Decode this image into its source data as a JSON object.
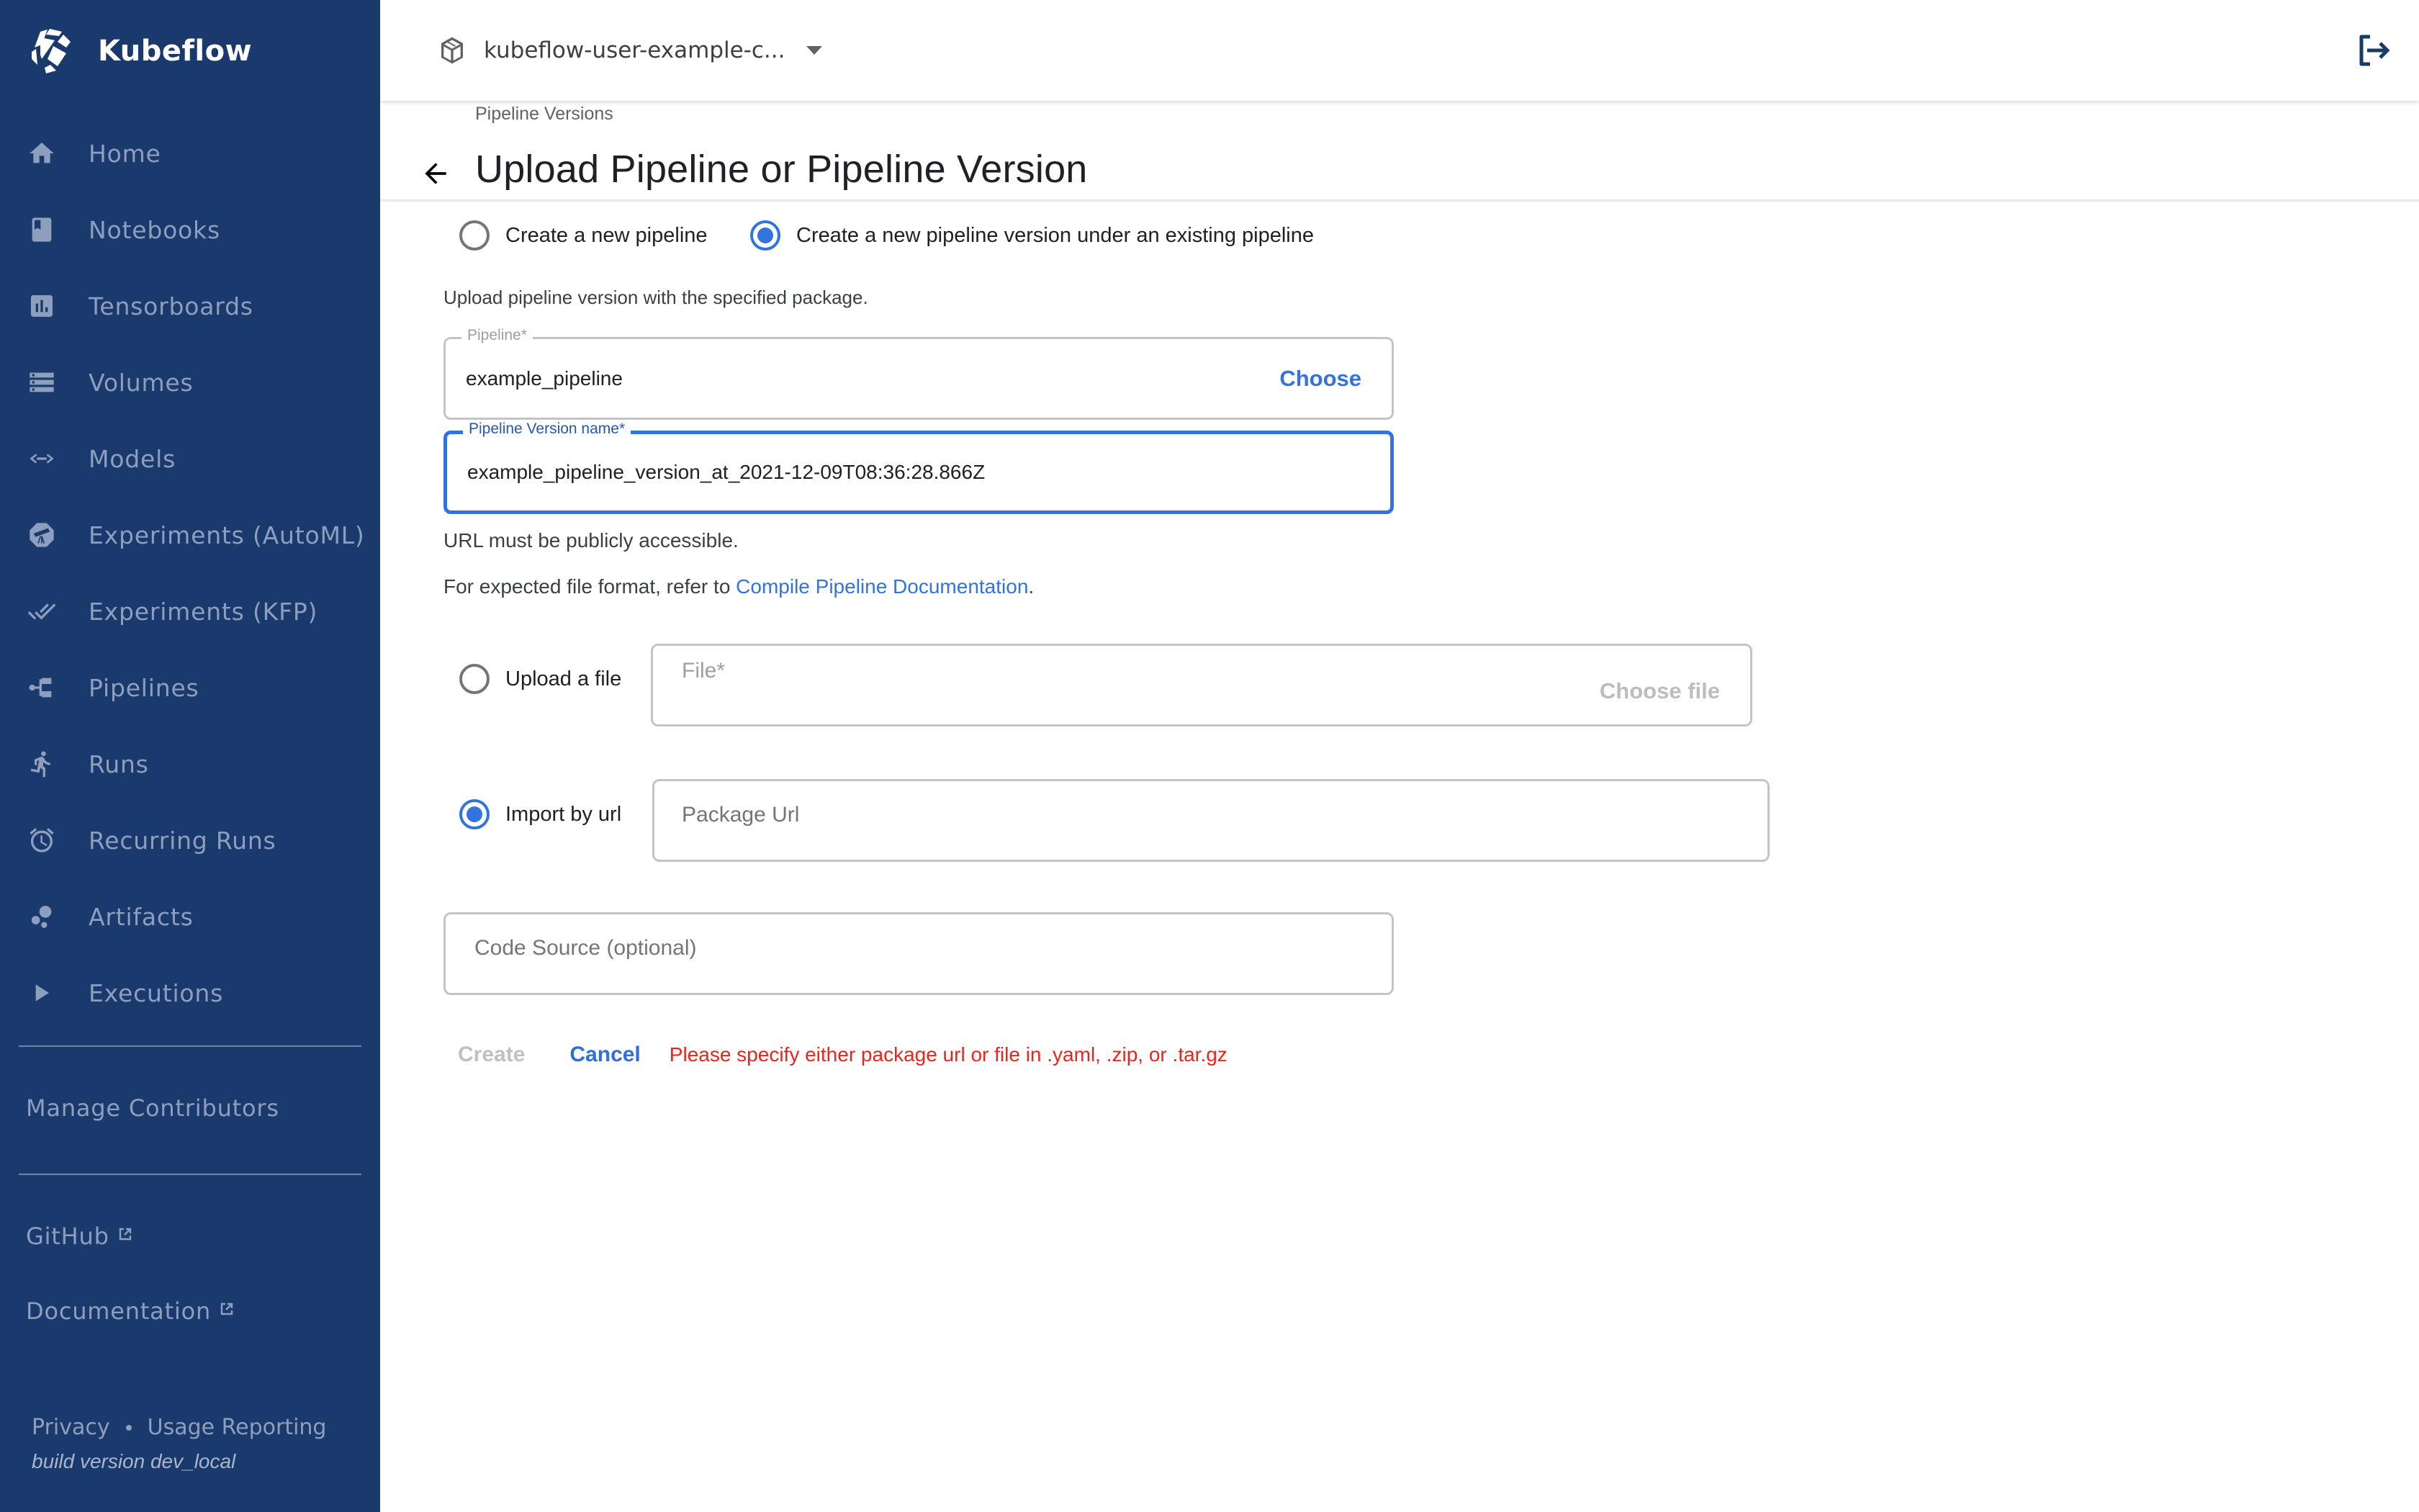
{
  "app": {
    "brand_name": "Kubeflow"
  },
  "sidebar": {
    "items": [
      {
        "label": "Home",
        "icon": "home-icon"
      },
      {
        "label": "Notebooks",
        "icon": "notebook-icon"
      },
      {
        "label": "Tensorboards",
        "icon": "bar-chart-icon"
      },
      {
        "label": "Volumes",
        "icon": "storage-icon"
      },
      {
        "label": "Models",
        "icon": "code-arrows-icon"
      },
      {
        "label": "Experiments (AutoML)",
        "icon": "telescope-icon"
      },
      {
        "label": "Experiments (KFP)",
        "icon": "done-all-icon"
      },
      {
        "label": "Pipelines",
        "icon": "pipeline-icon"
      },
      {
        "label": "Runs",
        "icon": "running-person-icon"
      },
      {
        "label": "Recurring Runs",
        "icon": "alarm-clock-icon"
      },
      {
        "label": "Artifacts",
        "icon": "bubbles-icon"
      },
      {
        "label": "Executions",
        "icon": "play-icon"
      }
    ],
    "manage_contributors": "Manage Contributors",
    "external_links": [
      {
        "label": "GitHub",
        "icon": "external-link-icon"
      },
      {
        "label": "Documentation",
        "icon": "external-link-icon"
      }
    ],
    "footer": {
      "privacy": "Privacy",
      "usage_reporting": "Usage Reporting",
      "build_version": "build version dev_local"
    }
  },
  "topbar": {
    "namespace": "kubeflow-user-example-c...",
    "namespace_icon": "cube-icon",
    "logout_icon": "logout-icon"
  },
  "page": {
    "breadcrumb": "Pipeline Versions",
    "title": "Upload Pipeline or Pipeline Version",
    "mode_options": [
      {
        "label": "Create a new pipeline",
        "checked": false
      },
      {
        "label": "Create a new pipeline version under an existing pipeline",
        "checked": true
      }
    ],
    "description": "Upload pipeline version with the specified package.",
    "pipeline_field": {
      "label": "Pipeline*",
      "value": "example_pipeline",
      "button": "Choose"
    },
    "version_name_field": {
      "label": "Pipeline Version name*",
      "value": "example_pipeline_version_at_2021-12-09T08:36:28.866Z"
    },
    "url_note": "URL must be publicly accessible.",
    "format_note_prefix": "For expected file format, refer to ",
    "format_note_link": "Compile Pipeline Documentation",
    "format_note_suffix": ".",
    "source_options": [
      {
        "label": "Upload a file",
        "checked": false
      },
      {
        "label": "Import by url",
        "checked": true
      }
    ],
    "file_field": {
      "placeholder": "File*",
      "button": "Choose file"
    },
    "package_url_field": {
      "placeholder": "Package Url",
      "value": ""
    },
    "code_source_field": {
      "placeholder": "Code Source (optional)",
      "value": ""
    },
    "actions": {
      "create": "Create",
      "cancel": "Cancel",
      "error": "Please specify either package url or file in .yaml, .zip, or .tar.gz"
    }
  },
  "colors": {
    "sidebar_bg": "#1a3a6e",
    "sidebar_text": "#8d9fbd",
    "accent": "#3373e0",
    "error": "#e8251e"
  }
}
